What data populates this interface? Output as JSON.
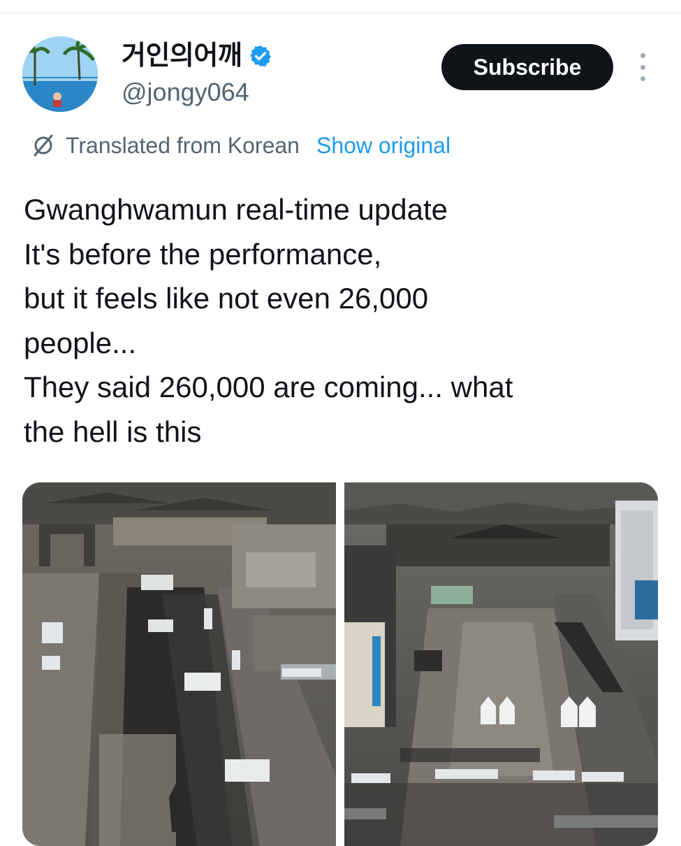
{
  "author": {
    "display_name": "거인의어깨",
    "handle": "@jongy064",
    "verified_icon": "verified-badge-icon",
    "badge_color": "#1d9bf0"
  },
  "actions": {
    "subscribe_label": "Subscribe",
    "more_icon": "more-options-icon"
  },
  "translation": {
    "icon": "translate-icon",
    "label": "Translated from Korean",
    "show_original": "Show original"
  },
  "tweet": {
    "lines": [
      "Gwanghwamun real-time update",
      "It's before the performance,",
      "but it feels like not even 26,000",
      "people...",
      "They said 260,000 are coming... what",
      "the hell is this"
    ]
  },
  "media": {
    "count": 2
  },
  "colors": {
    "text": "#0f1419",
    "muted": "#536471",
    "accent": "#1d9bf0",
    "button_bg": "#0f1419"
  }
}
